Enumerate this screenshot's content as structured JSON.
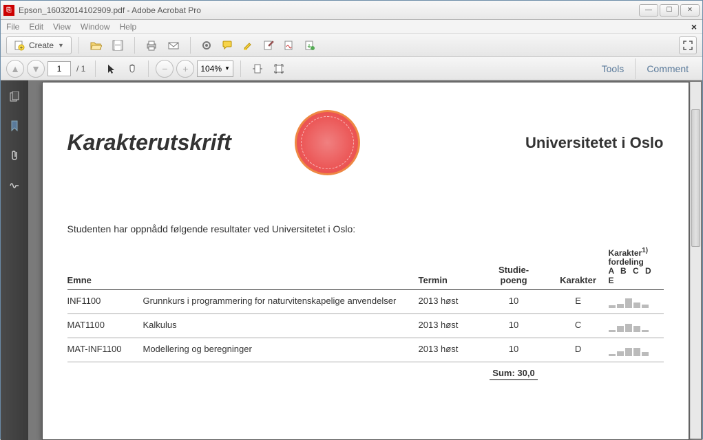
{
  "window": {
    "file_name": "Epson_16032014102909.pdf",
    "app_name": "Adobe Acrobat Pro"
  },
  "menubar": [
    "File",
    "Edit",
    "View",
    "Window",
    "Help"
  ],
  "toolbar": {
    "create_label": "Create"
  },
  "pager": {
    "current": "1",
    "total": "/ 1"
  },
  "zoom": {
    "value": "104%"
  },
  "side_links": {
    "tools": "Tools",
    "comment": "Comment"
  },
  "document": {
    "title": "Karakterutskrift",
    "university": "Universitetet i Oslo",
    "intro": "Studenten har oppnådd følgende resultater ved Universitetet i Oslo:",
    "headers": {
      "emne": "Emne",
      "termin": "Termin",
      "studiepoeng": "Studie-\npoeng",
      "karakter": "Karakter",
      "fordeling_top": "Karakter",
      "fordeling_sup": "1)",
      "fordeling_bot": "fordeling",
      "grades": "A B C D E"
    },
    "rows": [
      {
        "code": "INF1100",
        "name": "Grunnkurs i programmering for naturvitenskapelige anvendelser",
        "term": "2013 høst",
        "credits": "10",
        "grade": "E",
        "dist": [
          4,
          6,
          14,
          8,
          5
        ]
      },
      {
        "code": "MAT1100",
        "name": "Kalkulus",
        "term": "2013 høst",
        "credits": "10",
        "grade": "C",
        "dist": [
          3,
          9,
          12,
          9,
          3
        ]
      },
      {
        "code": "MAT-INF1100",
        "name": "Modellering og beregninger",
        "term": "2013 høst",
        "credits": "10",
        "grade": "D",
        "dist": [
          3,
          7,
          12,
          12,
          6
        ]
      }
    ],
    "sum_label": "Sum:",
    "sum_value": "30,0"
  }
}
